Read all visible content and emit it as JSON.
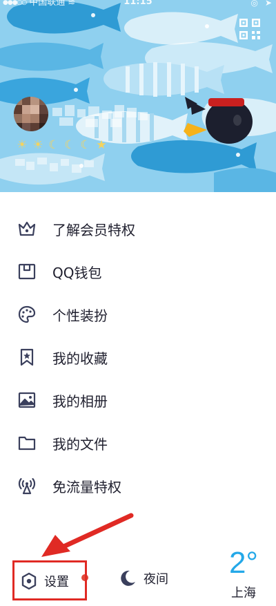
{
  "status_bar": {
    "carrier": "中国联通",
    "time": "11:15"
  },
  "header": {
    "qr_icon": "qr-code-icon",
    "level_badges": [
      "☀",
      "☀",
      "☾",
      "☾",
      "☾",
      "★"
    ]
  },
  "menu": {
    "items": [
      {
        "label": "了解会员特权",
        "icon": "crown-icon"
      },
      {
        "label": "QQ钱包",
        "icon": "wallet-icon"
      },
      {
        "label": "个性装扮",
        "icon": "palette-icon"
      },
      {
        "label": "我的收藏",
        "icon": "bookmark-star-icon"
      },
      {
        "label": "我的相册",
        "icon": "image-icon"
      },
      {
        "label": "我的文件",
        "icon": "folder-icon"
      },
      {
        "label": "免流量特权",
        "icon": "signal-tower-icon"
      }
    ]
  },
  "bottom_bar": {
    "settings_label": "设置",
    "night_label": "夜间",
    "weather": {
      "temperature": "2°",
      "city": "上海"
    }
  },
  "colors": {
    "accent": "#24a8e8",
    "icon": "#3a3f5c",
    "highlight": "#e02a24",
    "notification_dot": "#e14b3b"
  }
}
